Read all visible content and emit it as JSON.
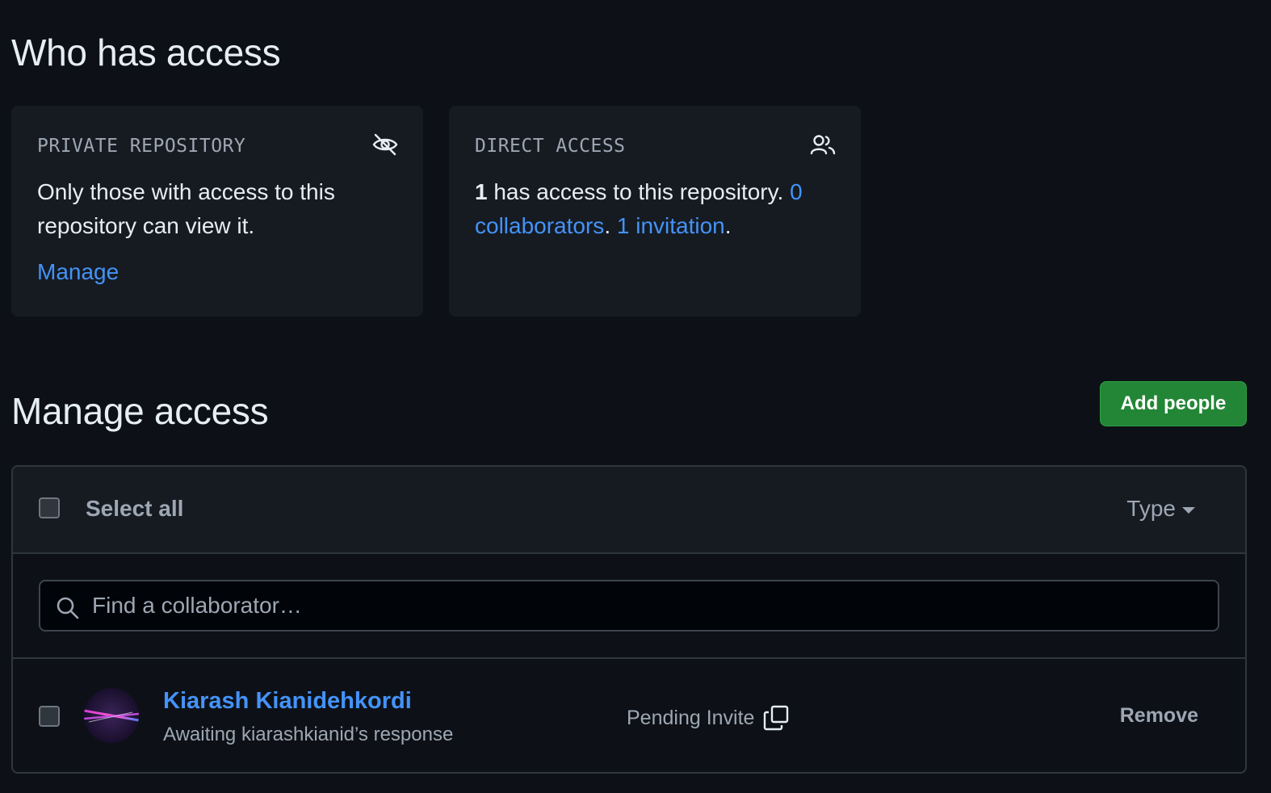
{
  "who_has_access": {
    "title": "Who has access",
    "private_card": {
      "caption": "PRIVATE REPOSITORY",
      "icon": "eye-closed-icon",
      "body": "Only those with access to this repository can view it.",
      "manage_link": "Manage"
    },
    "direct_card": {
      "caption": "DIRECT ACCESS",
      "icon": "people-icon",
      "count": "1",
      "body_text": " has access to this repository. ",
      "collaborators_link": "0 collaborators",
      "separator": ". ",
      "invitations_link": "1 invitation",
      "end": "."
    }
  },
  "manage_access": {
    "title": "Manage access",
    "add_button": "Add people",
    "select_all": "Select all",
    "type_filter": "Type",
    "search": {
      "placeholder": "Find a collaborator…",
      "value": ""
    },
    "rows": [
      {
        "name": "Kiarash Kianidehkordi",
        "subtitle": "Awaiting kiarashkianid’s response",
        "status": "Pending Invite",
        "action": "Remove"
      }
    ]
  },
  "colors": {
    "background": "#0d1117",
    "card": "#161b22",
    "link": "#4493f8",
    "primary_button": "#238636",
    "muted_text": "#9da7b3"
  }
}
